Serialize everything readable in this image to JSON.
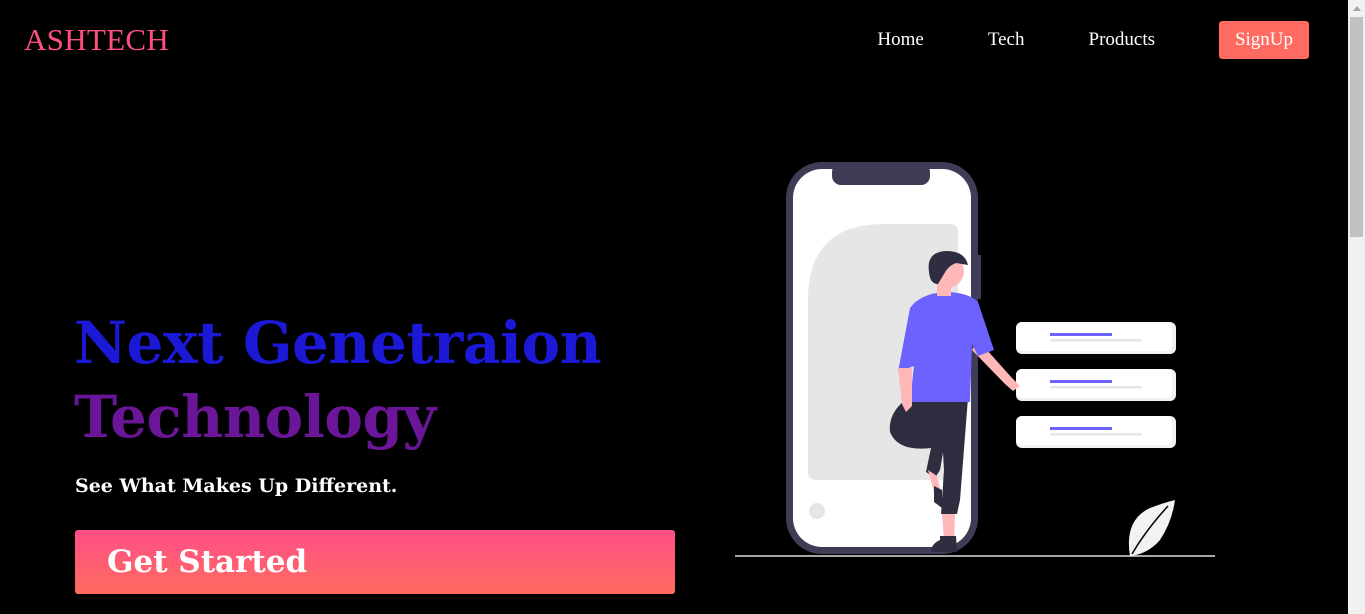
{
  "brand": {
    "logo_text": "ASHTECH"
  },
  "nav": {
    "items": [
      {
        "label": "Home"
      },
      {
        "label": "Tech"
      },
      {
        "label": "Products"
      }
    ],
    "signup_label": "SignUp"
  },
  "hero": {
    "title_line1": "Next Genetraion",
    "title_line2": "Technology",
    "subtitle": "See What Makes Up Different.",
    "cta_label": "Get Started"
  },
  "colors": {
    "background": "#000000",
    "logo": "#ff4f7f",
    "signup_button": "#ff6b61",
    "title_line1": "#1b18d6",
    "title_line2": "#6b1699",
    "cta_gradient_top": "#ff4f88",
    "cta_gradient_bottom": "#ff6b5e",
    "illustration_accent": "#6c63ff",
    "phone_frame": "#3f3d56"
  },
  "illustration": {
    "name": "person-leaning-on-phone-illustration"
  }
}
